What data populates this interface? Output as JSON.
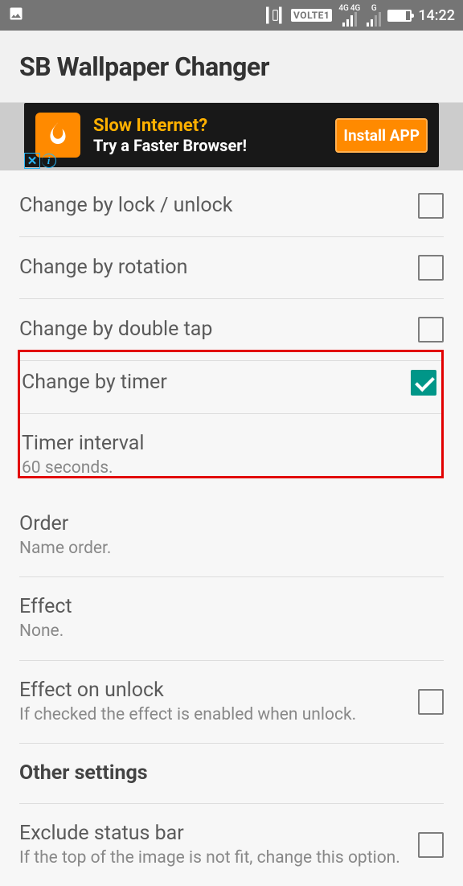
{
  "status": {
    "volte": "VOLTE1",
    "net1": "4G",
    "net2": "4G",
    "g": "G",
    "time": "14:22"
  },
  "appbar": {
    "title": "SB Wallpaper Changer"
  },
  "ad": {
    "line1": "Slow Internet?",
    "line2": "Try a Faster Browser!",
    "button": "Install APP"
  },
  "settings": {
    "lock": {
      "title": "Change by lock / unlock"
    },
    "rot": {
      "title": "Change by rotation"
    },
    "dtap": {
      "title": "Change by double tap"
    },
    "timer": {
      "title": "Change by timer"
    },
    "interval": {
      "title": "Timer interval",
      "sub": "60 seconds."
    },
    "order": {
      "title": "Order",
      "sub": "Name order."
    },
    "effect": {
      "title": "Effect",
      "sub": "None."
    },
    "eunlock": {
      "title": "Effect on unlock",
      "sub": "If checked the effect is enabled when unlock."
    },
    "section": {
      "title": "Other settings"
    },
    "exclude": {
      "title": "Exclude status bar",
      "sub": "If the top of the image is not fit, change this option."
    }
  }
}
